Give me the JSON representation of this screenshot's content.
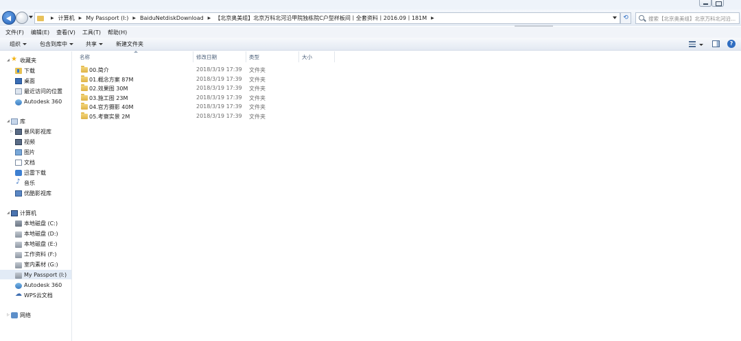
{
  "address": {
    "crumbs": [
      "计算机",
      "My Passport (I:)",
      "BaiduNetdiskDownload",
      "【北京奥美组】北京万科北河沿甲院独栋院C户型样板间丨全套资料丨2016.09丨181M"
    ],
    "search_placeholder": "搜索【北京奥美组】北京万科北河沿..."
  },
  "menu": [
    "文件(F)",
    "编辑(E)",
    "查看(V)",
    "工具(T)",
    "帮助(H)"
  ],
  "toolbar": {
    "organize": "组织",
    "include_library": "包含到库中",
    "share": "共享",
    "new_folder": "新建文件夹",
    "help_glyph": "?"
  },
  "sidebar": {
    "favorites": {
      "label": "收藏夹",
      "items": [
        "下载",
        "桌面",
        "最近访问的位置",
        "Autodesk 360"
      ]
    },
    "libraries": {
      "label": "库",
      "items": [
        "暴风影视库",
        "视频",
        "图片",
        "文档",
        "迅雷下载",
        "音乐",
        "优酷影视库"
      ]
    },
    "computer": {
      "label": "计算机",
      "items": [
        "本地磁盘 (C:)",
        "本地磁盘 (D:)",
        "本地磁盘 (E:)",
        "工作资料 (F:)",
        "室内素材 (G:)",
        "My Passport (I:)",
        "Autodesk 360",
        "WPS云文档"
      ]
    },
    "network": {
      "label": "网络"
    }
  },
  "columns": [
    "名称",
    "修改日期",
    "类型",
    "大小"
  ],
  "files": [
    {
      "name": "00.简介",
      "date": "2018/3/19 17:39",
      "type": "文件夹"
    },
    {
      "name": "01.概念方案 87M",
      "date": "2018/3/19 17:39",
      "type": "文件夹"
    },
    {
      "name": "02.效果图 30M",
      "date": "2018/3/19 17:39",
      "type": "文件夹"
    },
    {
      "name": "03.施工图 23M",
      "date": "2018/3/19 17:39",
      "type": "文件夹"
    },
    {
      "name": "04.官方摄影 40M",
      "date": "2018/3/19 17:39",
      "type": "文件夹"
    },
    {
      "name": "05.考察实景 2M",
      "date": "2018/3/19 17:39",
      "type": "文件夹"
    }
  ],
  "colors": {
    "accent": "#2f6dc1",
    "folder": "#e5c053",
    "selected_bg": "#e2ebf6"
  }
}
